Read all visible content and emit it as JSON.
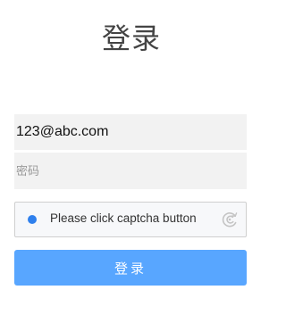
{
  "page": {
    "title": "登录"
  },
  "form": {
    "email_value": "123@abc.com",
    "password_placeholder": "密码",
    "captcha": {
      "label": "Please click captcha button",
      "icon": "captcha-refresh-icon",
      "dot_color": "#2f80ed"
    },
    "submit_label": "登录",
    "submit_color": "#58a6ff"
  }
}
